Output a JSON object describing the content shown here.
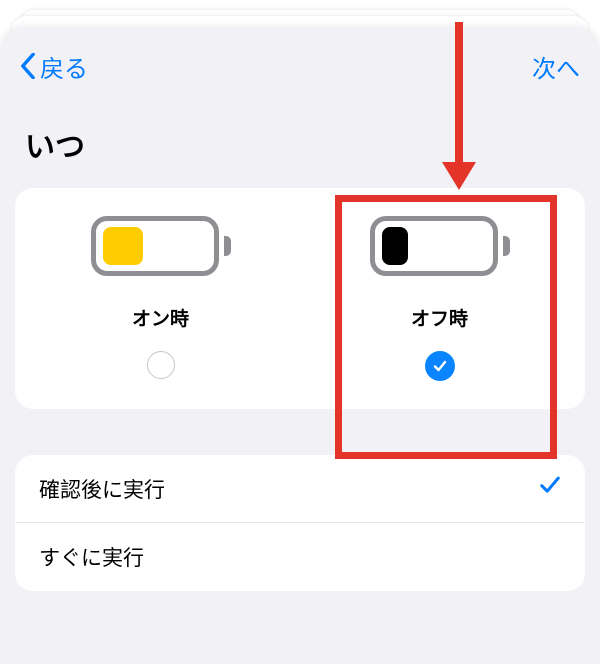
{
  "nav": {
    "back": "戻る",
    "next": "次へ"
  },
  "title": "いつ",
  "options": {
    "on": {
      "label": "オン時",
      "selected": false
    },
    "off": {
      "label": "オフ時",
      "selected": true
    }
  },
  "run_mode": {
    "confirm": {
      "label": "確認後に実行",
      "selected": true
    },
    "immediate": {
      "label": "すぐに実行",
      "selected": false
    }
  },
  "colors": {
    "accent": "#007aff",
    "battery_low_yellow": "#ffcc00",
    "annotation_red": "#e4342a"
  }
}
